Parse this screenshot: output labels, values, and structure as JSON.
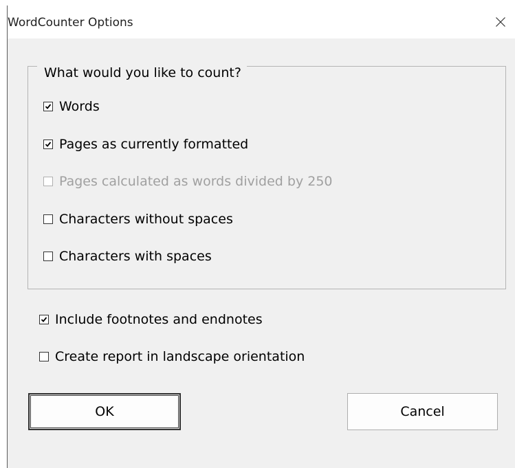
{
  "dialog": {
    "title": "WordCounter Options",
    "close_glyph": "close-icon"
  },
  "count_group": {
    "legend": "What would you like to count?",
    "options": [
      {
        "label": "Words",
        "checked": true,
        "enabled": true
      },
      {
        "label": "Pages as currently formatted",
        "checked": true,
        "enabled": true
      },
      {
        "label": "Pages calculated as words divided by 250",
        "checked": false,
        "enabled": false
      },
      {
        "label": "Characters without spaces",
        "checked": false,
        "enabled": true
      },
      {
        "label": "Characters with spaces",
        "checked": false,
        "enabled": true
      }
    ]
  },
  "extra_options": [
    {
      "label": "Include footnotes and endnotes",
      "checked": true,
      "enabled": true
    },
    {
      "label": "Create report in landscape orientation",
      "checked": false,
      "enabled": true
    }
  ],
  "buttons": {
    "ok_label": "OK",
    "cancel_label": "Cancel"
  },
  "colors": {
    "window_bg": "#f0f0f0",
    "titlebar_bg": "#ffffff",
    "disabled_text": "#a0a0a0"
  }
}
